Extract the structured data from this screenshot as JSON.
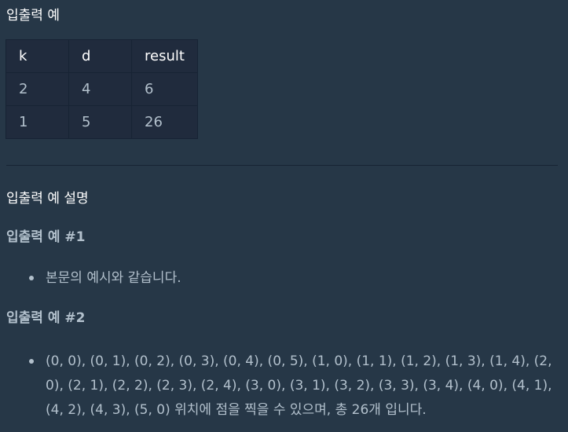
{
  "section_title": "입출력 예",
  "table": {
    "headers": [
      "k",
      "d",
      "result"
    ],
    "rows": [
      [
        "2",
        "4",
        "6"
      ],
      [
        "1",
        "5",
        "26"
      ]
    ]
  },
  "explanation_title": "입출력 예 설명",
  "examples": [
    {
      "heading": "입출력 예 #1",
      "bullets": [
        "본문의 예시와 같습니다."
      ]
    },
    {
      "heading": "입출력 예 #2",
      "bullets": [
        "(0, 0), (0, 1), (0, 2), (0, 3), (0, 4), (0, 5), (1, 0), (1, 1), (1, 2), (1, 3), (1, 4), (2, 0), (2, 1), (2, 2), (2, 3), (2, 4), (3, 0), (3, 1), (3, 2), (3, 3), (3, 4), (4, 0), (4, 1), (4, 2), (4, 3), (5, 0) 위치에 점을 찍을 수 있으며, 총 26개 입니다."
      ]
    }
  ],
  "colors": {
    "background": "#263747",
    "table_cell": "#202b3d",
    "border": "#172334",
    "heading_text": "#ffffff",
    "body_text": "#b2c0cc"
  }
}
